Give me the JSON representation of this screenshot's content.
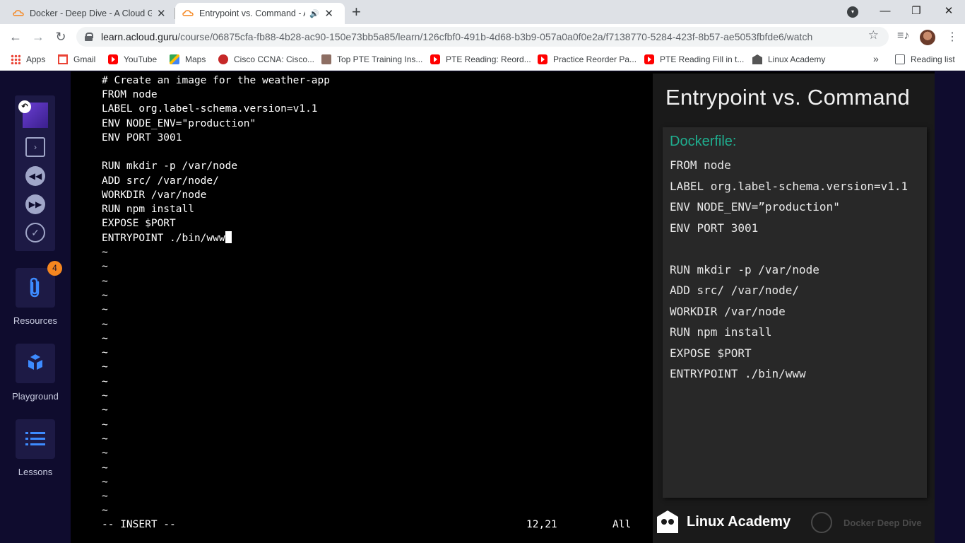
{
  "browser": {
    "tabs": [
      {
        "title": "Docker - Deep Dive - A Cloud Gu",
        "close": "✕"
      },
      {
        "title": "Entrypoint vs. Command - A",
        "audio": "🔊",
        "close": "✕"
      }
    ],
    "new_tab": "+",
    "window_controls": {
      "minimize": "—",
      "restore": "❐",
      "close": "✕"
    },
    "nav": {
      "back": "←",
      "forward": "→",
      "reload": "↻"
    },
    "url_host": "learn.acloud.guru",
    "url_path": "/course/06875cfa-fb88-4b28-ac90-150e73bb5a85/learn/126cfbf0-491b-4d68-b3b9-057a0a0f0e2a/f7138770-5284-423f-8b57-ae5053fbfde6/watch",
    "star": "☆",
    "media_icon": "≡♪",
    "menu_icon": "⋮",
    "bookmarks": [
      {
        "label": "Apps",
        "icon": "apps-icon"
      },
      {
        "label": "Gmail",
        "icon": "gmail-icon"
      },
      {
        "label": "YouTube",
        "icon": "youtube-icon"
      },
      {
        "label": "Maps",
        "icon": "maps-icon"
      },
      {
        "label": "Cisco CCNA: Cisco...",
        "icon": "cisco-icon"
      },
      {
        "label": "Top PTE Training Ins...",
        "icon": "pte-icon"
      },
      {
        "label": "PTE Reading: Reord...",
        "icon": "youtube-icon"
      },
      {
        "label": "Practice Reorder Pa...",
        "icon": "youtube-icon"
      },
      {
        "label": "PTE Reading Fill in t...",
        "icon": "youtube-icon"
      },
      {
        "label": "Linux Academy",
        "icon": "linux-academy-icon"
      }
    ],
    "bookmarks_overflow": "»",
    "reading_list": "Reading list"
  },
  "sidebar": {
    "player": {
      "back_badge": "↶",
      "prev": "◀◀",
      "next": "▶▶",
      "complete": "✓",
      "collapse": "›"
    },
    "resources": {
      "label": "Resources",
      "badge": "4"
    },
    "playground": {
      "label": "Playground"
    },
    "lessons": {
      "label": "Lessons"
    }
  },
  "terminal": {
    "lines": [
      "# Create an image for the weather-app",
      "FROM node",
      "LABEL org.label-schema.version=v1.1",
      "ENV NODE_ENV=\"production\"",
      "ENV PORT 3001",
      "",
      "RUN mkdir -p /var/node",
      "ADD src/ /var/node/",
      "WORKDIR /var/node",
      "RUN npm install",
      "EXPOSE $PORT",
      "ENTRYPOINT ./bin/www"
    ],
    "tilde": "~",
    "mode": "-- INSERT --",
    "position": "12,21",
    "scroll": "All"
  },
  "slide": {
    "title": "Entrypoint vs. Command",
    "card_title": "Dockerfile:",
    "lines": [
      "FROM node",
      "LABEL org.label-schema.version=v1.1",
      "ENV NODE_ENV=”production\"",
      "ENV PORT 3001",
      "",
      "RUN mkdir -p /var/node",
      "ADD src/ /var/node/",
      "WORKDIR /var/node",
      "RUN npm install",
      "EXPOSE $PORT",
      "ENTRYPOINT ./bin/www"
    ],
    "brand": "Linux Academy",
    "course_brand": "Docker Deep Dive"
  },
  "colors": {
    "sidebar_bg": "#0f0c2e",
    "panel_bg": "#1d1a45",
    "accent_orange": "#f5861f",
    "slide_accent": "#1fae8f"
  }
}
